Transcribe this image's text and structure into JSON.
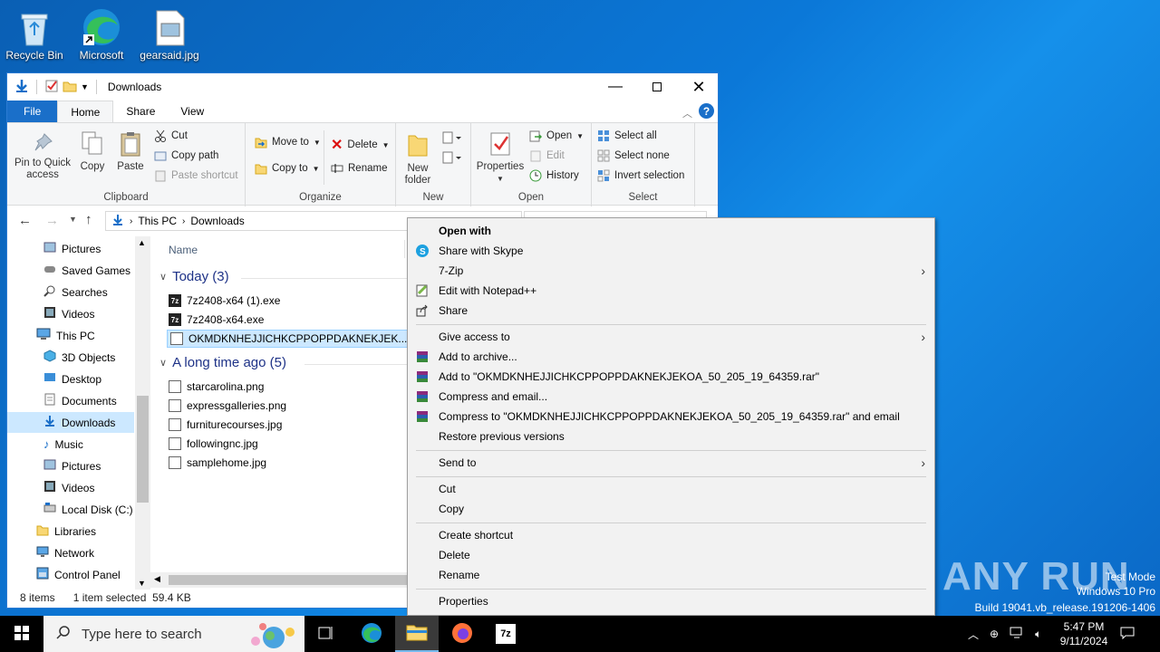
{
  "desktop": {
    "icons": [
      {
        "label": "Recycle Bin"
      },
      {
        "label": "Microsoft Edge"
      },
      {
        "label": "gearsaid.jpg"
      }
    ]
  },
  "window": {
    "title": "Downloads",
    "tabs": {
      "file": "File",
      "home": "Home",
      "share": "Share",
      "view": "View"
    },
    "ribbon": {
      "clipboard": {
        "pin": "Pin to Quick access",
        "copy": "Copy",
        "paste": "Paste",
        "cut": "Cut",
        "copy_path": "Copy path",
        "paste_shortcut": "Paste shortcut",
        "label": "Clipboard"
      },
      "organize": {
        "move_to": "Move to",
        "copy_to": "Copy to",
        "delete": "Delete",
        "rename": "Rename",
        "label": "Organize"
      },
      "new": {
        "new_folder": "New folder",
        "label": "New"
      },
      "open": {
        "properties": "Properties",
        "open": "Open",
        "edit": "Edit",
        "history": "History",
        "label": "Open"
      },
      "select": {
        "select_all": "Select all",
        "select_none": "Select none",
        "invert": "Invert selection",
        "label": "Select"
      }
    },
    "address": {
      "this_pc": "This PC",
      "folder": "Downloads"
    },
    "nav_items": [
      {
        "label": "Pictures"
      },
      {
        "label": "Saved Games"
      },
      {
        "label": "Searches"
      },
      {
        "label": "Videos"
      },
      {
        "label": "This PC"
      },
      {
        "label": "3D Objects"
      },
      {
        "label": "Desktop"
      },
      {
        "label": "Documents"
      },
      {
        "label": "Downloads"
      },
      {
        "label": "Music"
      },
      {
        "label": "Pictures"
      },
      {
        "label": "Videos"
      },
      {
        "label": "Local Disk (C:)"
      },
      {
        "label": "Libraries"
      },
      {
        "label": "Network"
      },
      {
        "label": "Control Panel"
      }
    ],
    "column_name": "Name",
    "groups": [
      {
        "label": "Today (3)",
        "files": [
          "7z2408-x64 (1).exe",
          "7z2408-x64.exe",
          "OKMDKNHEJJICHKCPPOPPDAKNEKJEK..."
        ]
      },
      {
        "label": "A long time ago (5)",
        "files": [
          "starcarolina.png",
          "expressgalleries.png",
          "furniturecourses.jpg",
          "followingnc.jpg",
          "samplehome.jpg"
        ]
      }
    ],
    "status": {
      "count": "8 items",
      "selected": "1 item selected  59.4 KB"
    }
  },
  "context_menu": {
    "items": [
      {
        "label": "Open with"
      },
      {
        "label": "Share with Skype"
      },
      {
        "label": "7-Zip"
      },
      {
        "label": "Edit with Notepad++"
      },
      {
        "label": "Share"
      },
      {
        "label": "Give access to"
      },
      {
        "label": "Add to archive..."
      },
      {
        "label": "Add to \"OKMDKNHEJJICHKCPPOPPDAKNEKJEKOA_50_205_19_64359.rar\""
      },
      {
        "label": "Compress and email..."
      },
      {
        "label": "Compress to \"OKMDKNHEJJICHKCPPOPPDAKNEKJEKOA_50_205_19_64359.rar\" and email"
      },
      {
        "label": "Restore previous versions"
      },
      {
        "label": "Send to"
      },
      {
        "label": "Cut"
      },
      {
        "label": "Copy"
      },
      {
        "label": "Create shortcut"
      },
      {
        "label": "Delete"
      },
      {
        "label": "Rename"
      },
      {
        "label": "Properties"
      }
    ]
  },
  "taskbar": {
    "search_placeholder": "Type here to search",
    "time": "5:47 PM",
    "date": "9/11/2024"
  },
  "watermark": {
    "logo": "ANY RUN",
    "line1": "Test Mode",
    "line2": "Windows 10 Pro",
    "line3": "Build 19041.vb_release.191206-1406"
  },
  "colors": {
    "accent": "#1a6fc9",
    "selection": "#cce8ff",
    "taskbar": "#000000"
  }
}
